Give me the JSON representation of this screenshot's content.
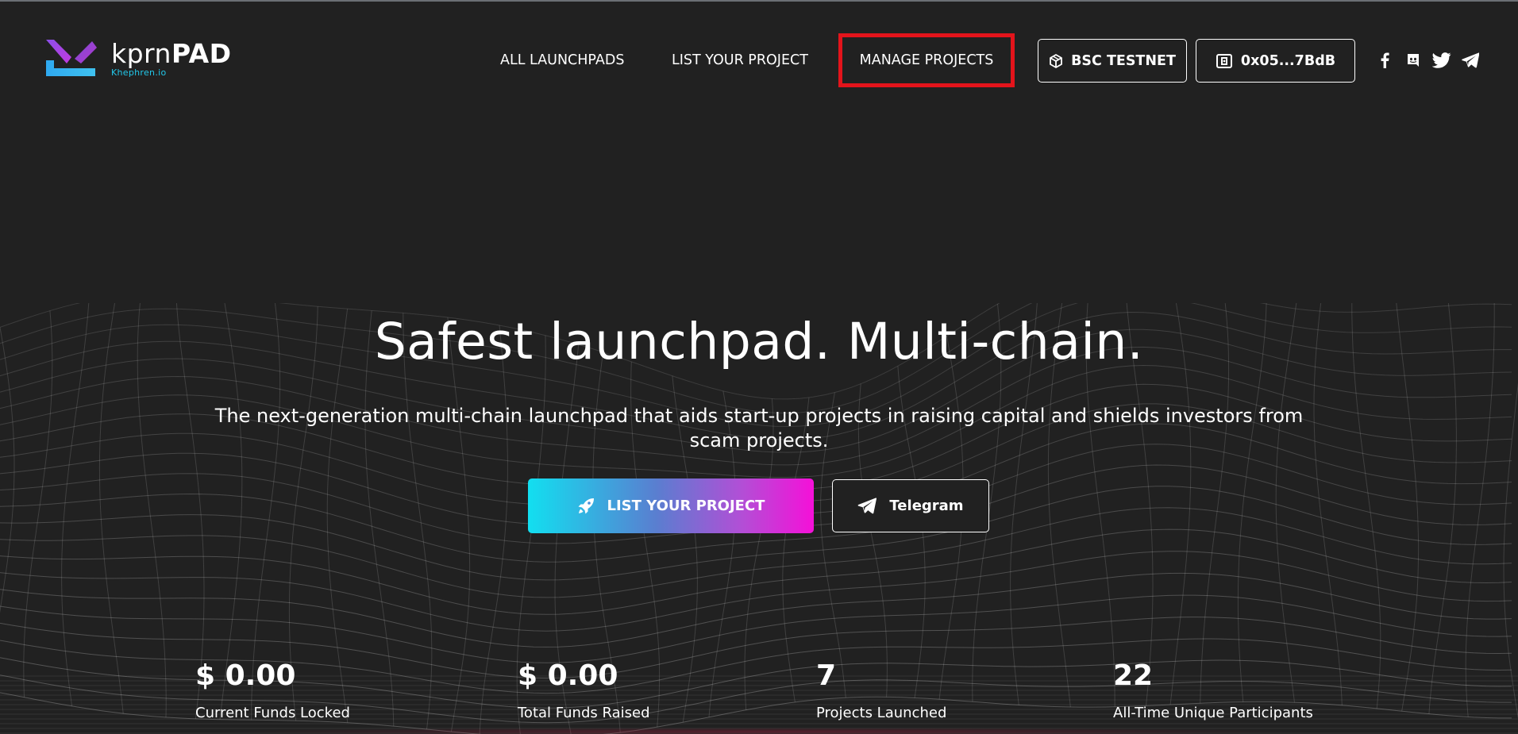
{
  "header": {
    "logo": {
      "name_thin": "kprn",
      "name_bold": "PAD",
      "subtitle": "Khephren.io"
    },
    "nav": [
      {
        "label": "ALL LAUNCHPADS"
      },
      {
        "label": "LIST YOUR PROJECT"
      },
      {
        "label": "MANAGE PROJECTS",
        "highlighted": true
      }
    ],
    "network_button": {
      "label": "BSC TESTNET",
      "icon": "cube-icon"
    },
    "wallet_button": {
      "label": "0x05...7BdB",
      "icon": "wallet-icon"
    },
    "socials": [
      {
        "icon": "facebook-icon"
      },
      {
        "icon": "discord-icon"
      },
      {
        "icon": "twitter-icon"
      },
      {
        "icon": "telegram-icon"
      }
    ]
  },
  "hero": {
    "title": "Safest launchpad. Multi-chain.",
    "subtitle": "The next-generation multi-chain launchpad that aids start-up projects in raising capital and shields investors from scam projects.",
    "primary_cta": {
      "label": "LIST YOUR PROJECT",
      "icon": "rocket-icon"
    },
    "secondary_cta": {
      "label": "Telegram",
      "icon": "telegram-icon"
    }
  },
  "stats": [
    {
      "value": "$ 0.00",
      "label": "Current Funds Locked"
    },
    {
      "value": "$ 0.00",
      "label": "Total Funds Raised"
    },
    {
      "value": "7",
      "label": "Projects Launched"
    },
    {
      "value": "22",
      "label": "All-Time Unique Participants"
    }
  ],
  "colors": {
    "background": "#212121",
    "highlight": "#e3141b",
    "accent_cyan": "#12dff0",
    "accent_magenta": "#f510d8",
    "logo_blue": "#22c8ea"
  }
}
